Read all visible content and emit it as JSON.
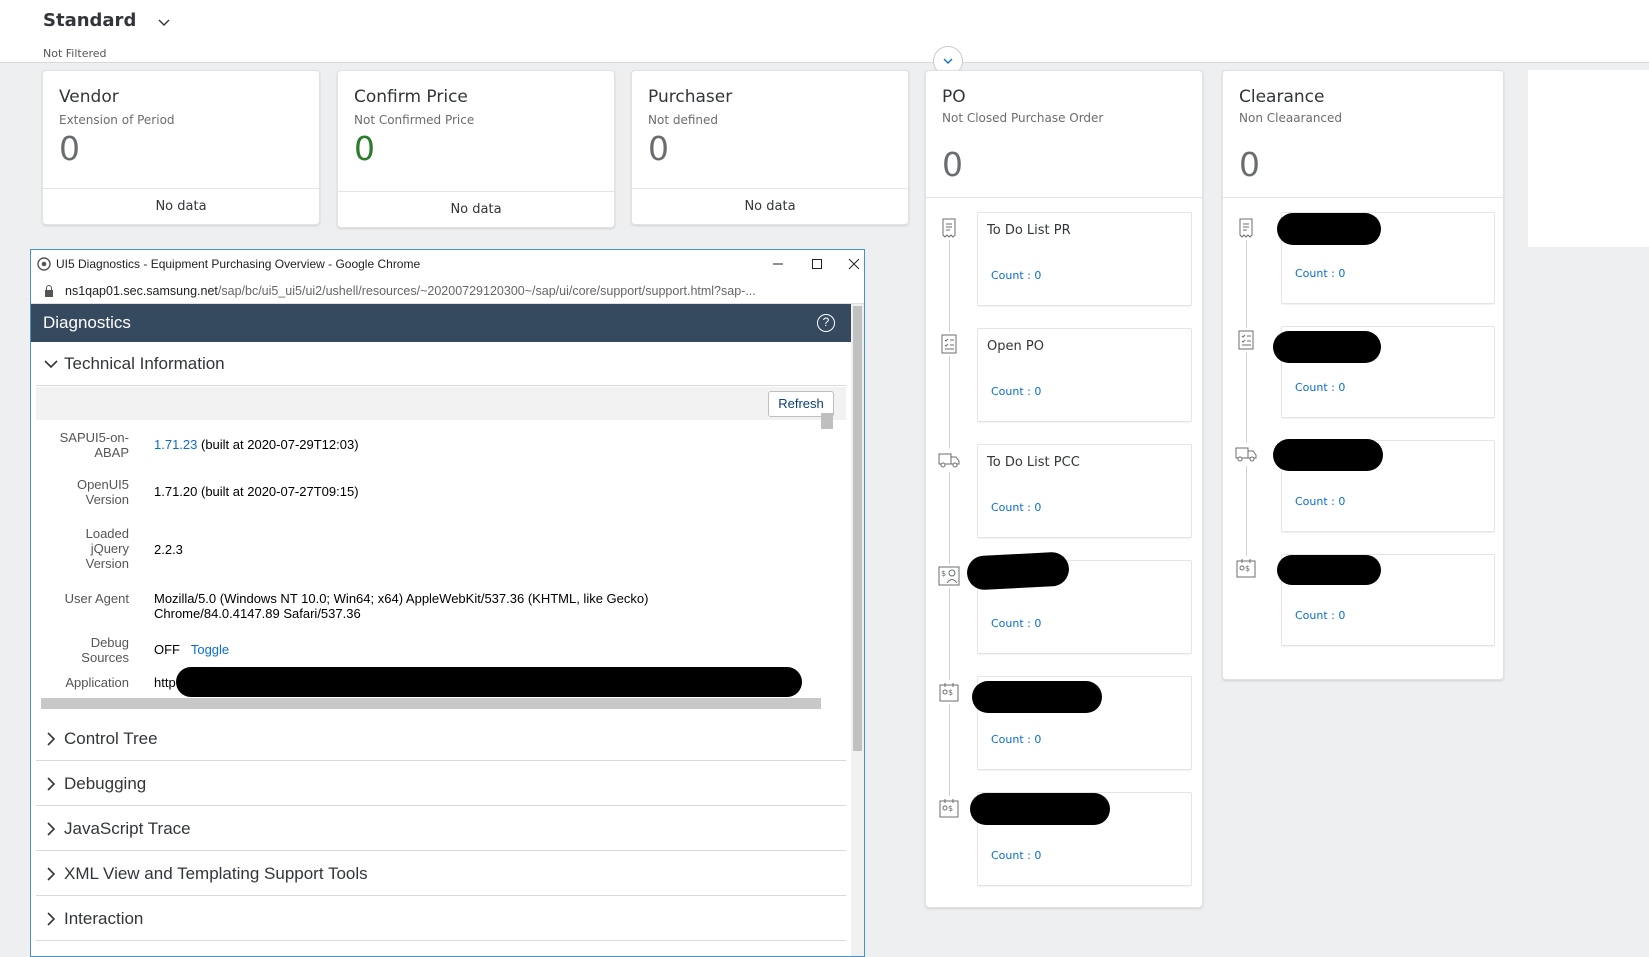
{
  "header": {
    "variant": "Standard",
    "filter_status": "Not Filtered"
  },
  "kpi_cards": [
    {
      "title": "Vendor",
      "subtitle": "Extension of Period",
      "value": "0",
      "footer": "No data"
    },
    {
      "title": "Confirm Price",
      "subtitle": "Not Confirmed Price",
      "value": "0",
      "footer": "No data"
    },
    {
      "title": "Purchaser",
      "subtitle": "Not defined",
      "value": "0",
      "footer": "No data"
    }
  ],
  "po_card": {
    "title": "PO",
    "subtitle": "Not Closed Purchase Order",
    "value": "0",
    "items": [
      {
        "icon": "receipt-icon",
        "label": "To Do List PR",
        "count": "Count : 0"
      },
      {
        "icon": "checklist-icon",
        "label": "Open PO",
        "count": "Count : 0"
      },
      {
        "icon": "truck-icon",
        "label": "To Do List PCC",
        "count": "Count : 0"
      },
      {
        "icon": "person-money-icon",
        "label": "",
        "count": "Count : 0"
      },
      {
        "icon": "document-money-icon",
        "label": "",
        "count": "Count : 0"
      },
      {
        "icon": "document-money-icon",
        "label": "",
        "count": "Count : 0"
      }
    ]
  },
  "clearance_card": {
    "title": "Clearance",
    "subtitle": "Non Cleaaranced",
    "value": "0",
    "items": [
      {
        "icon": "receipt-icon",
        "label": "",
        "count": "Count : 0"
      },
      {
        "icon": "checklist-icon",
        "label": "",
        "count": "Count : 0"
      },
      {
        "icon": "truck-icon",
        "label": "",
        "count": "Count : 0"
      },
      {
        "icon": "document-money-icon",
        "label": "",
        "count": "Count : 0"
      }
    ]
  },
  "popup": {
    "window_title": "UI5 Diagnostics - Equipment Purchasing Overview - Google Chrome",
    "url_host": "ns1qap01.sec.samsung.net",
    "url_path": "/sap/bc/ui5_ui5/ui2/ushell/resources/~20200729120300~/sap/ui/core/support/support.html?sap-...",
    "diag_title": "Diagnostics",
    "help_glyph": "?",
    "section_open": "Technical Information",
    "refresh_label": "Refresh",
    "info": {
      "sapui5_key_1": "SAPUI5-on-",
      "sapui5_key_2": "ABAP",
      "sapui5_link": "1.71.23",
      "sapui5_rest": " (built at 2020-07-29T12:03)",
      "openui5_key_1": "OpenUI5",
      "openui5_key_2": "Version",
      "openui5_val": "1.71.20 (built at 2020-07-27T09:15)",
      "jquery_key_1": "Loaded",
      "jquery_key_2": "jQuery",
      "jquery_key_3": "Version",
      "jquery_val": "2.2.3",
      "ua_key": "User Agent",
      "ua_val_1": "Mozilla/5.0 (Windows NT 10.0; Win64; x64) AppleWebKit/537.36 (KHTML, like Gecko)",
      "ua_val_2": "Chrome/84.0.4147.89 Safari/537.36",
      "debug_key_1": "Debug",
      "debug_key_2": "Sources",
      "debug_val": "OFF",
      "debug_toggle": "Toggle",
      "app_key": "Application",
      "app_val": "http"
    },
    "sections": [
      "Control Tree",
      "Debugging",
      "JavaScript Trace",
      "XML View and Templating Support Tools",
      "Interaction"
    ]
  }
}
